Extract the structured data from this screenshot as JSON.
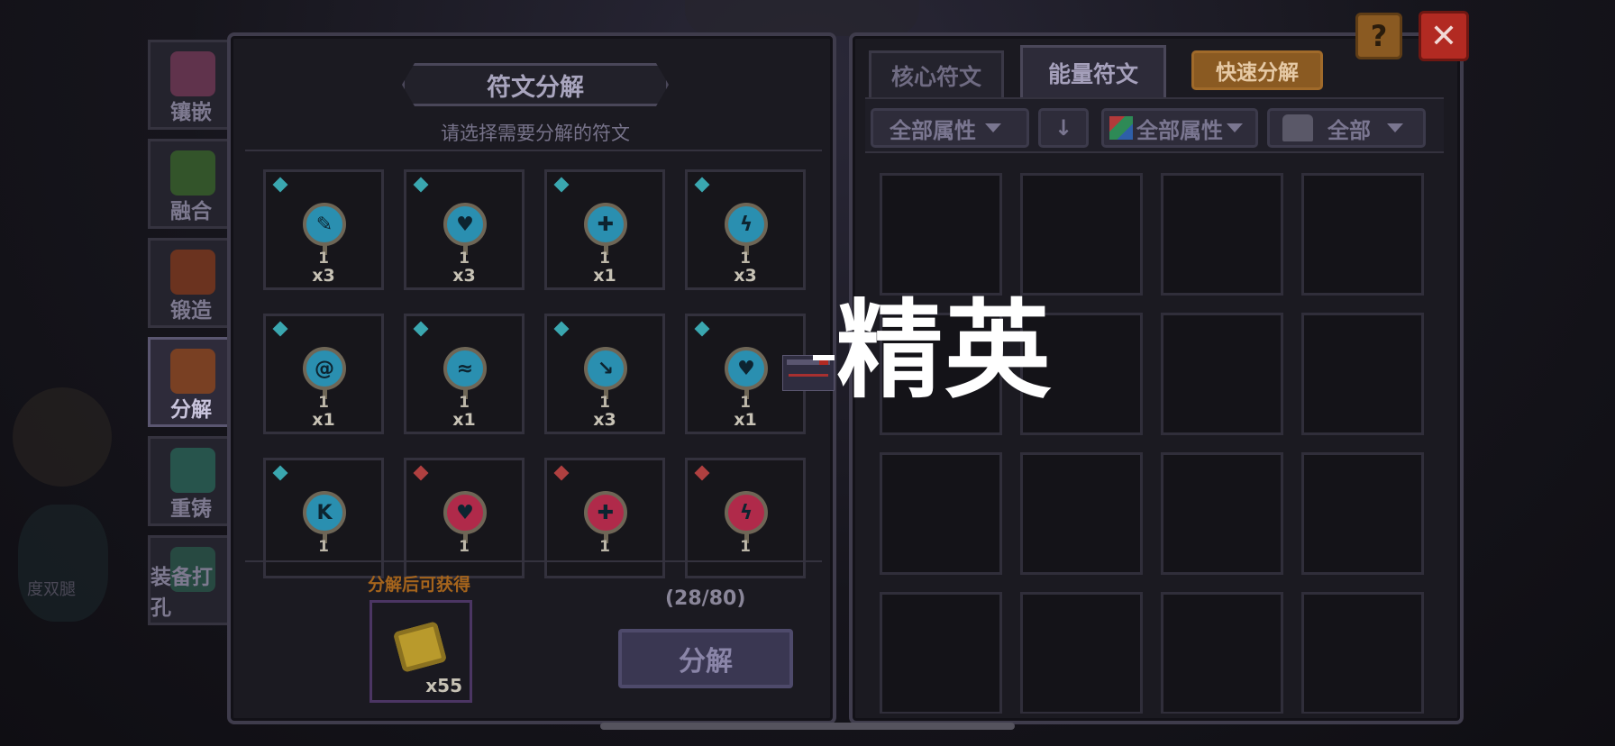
{
  "side_nav": [
    {
      "label": "镶嵌",
      "icon": "inlay-icon",
      "color": "#7a3a5a",
      "active": false
    },
    {
      "label": "融合",
      "icon": "fusion-icon",
      "color": "#3a6a2a",
      "active": false
    },
    {
      "label": "锻造",
      "icon": "forge-icon",
      "color": "#8a3a1a",
      "active": false
    },
    {
      "label": "分解",
      "icon": "decompose-icon",
      "color": "#9a4a1a",
      "active": true
    },
    {
      "label": "重铸",
      "icon": "recast-icon",
      "color": "#2a6a5a",
      "active": false
    },
    {
      "label": "装备打孔",
      "icon": "socket-punch-icon",
      "color": "#2a5a4a",
      "active": false
    }
  ],
  "left_panel": {
    "title": "符文分解",
    "subtitle": "请选择需要分解的符文",
    "runes": [
      {
        "symbol": "✎",
        "level": "1",
        "qty": "x3",
        "gem": "#3aa7b0",
        "orb": "#2a8fb0"
      },
      {
        "symbol": "♥",
        "level": "1",
        "qty": "x3",
        "gem": "#3aa7b0",
        "orb": "#2a8fb0"
      },
      {
        "symbol": "✚",
        "level": "1",
        "qty": "x1",
        "gem": "#3aa7b0",
        "orb": "#2a8fb0"
      },
      {
        "symbol": "ϟ",
        "level": "1",
        "qty": "x3",
        "gem": "#3aa7b0",
        "orb": "#2a8fb0"
      },
      {
        "symbol": "@",
        "level": "1",
        "qty": "x1",
        "gem": "#3aa7b0",
        "orb": "#2a8fb0"
      },
      {
        "symbol": "≈",
        "level": "1",
        "qty": "x1",
        "gem": "#3aa7b0",
        "orb": "#2a8fb0"
      },
      {
        "symbol": "↘",
        "level": "1",
        "qty": "x3",
        "gem": "#3aa7b0",
        "orb": "#2a8fb0"
      },
      {
        "symbol": "♥",
        "level": "1",
        "qty": "x1",
        "gem": "#3aa7b0",
        "orb": "#2a8fb0"
      },
      {
        "symbol": "K",
        "level": "1",
        "qty": "",
        "gem": "#3aa7b0",
        "orb": "#2a8fb0"
      },
      {
        "symbol": "♥",
        "level": "1",
        "qty": "",
        "gem": "#b04040",
        "orb": "#b02a4a"
      },
      {
        "symbol": "✚",
        "level": "1",
        "qty": "",
        "gem": "#b04040",
        "orb": "#b02a4a"
      },
      {
        "symbol": "ϟ",
        "level": "1",
        "qty": "",
        "gem": "#b04040",
        "orb": "#b02a4a"
      }
    ],
    "gain_label": "分解后可获得",
    "gain_qty": "x55",
    "capacity": "(28/80)",
    "decompose_button": "分解"
  },
  "right_panel": {
    "tabs": [
      {
        "label": "核心符文",
        "active": false
      },
      {
        "label": "能量符文",
        "active": true
      }
    ],
    "quick_decompose": "快速分解",
    "filters": {
      "attr1": "全部属性",
      "sort_icon": "↓",
      "attr2": "全部属性",
      "equip": "全部"
    },
    "empty_slots": 16
  },
  "top_buttons": {
    "help": "?",
    "close": "✕"
  },
  "overlay": {
    "text": "精英"
  },
  "background_text": "度双腿"
}
